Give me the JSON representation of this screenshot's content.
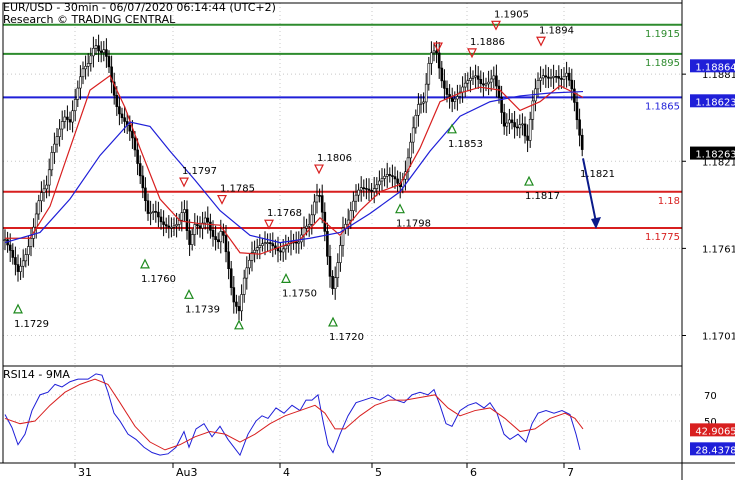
{
  "header": {
    "title": "EUR/USD - 30min - 06/07/2020 06:14:44 (UTC+2)",
    "source": "Research © TRADING CENTRAL"
  },
  "rsi_panel": {
    "title": "RSI14 - 9MA"
  },
  "chart_data": [
    {
      "type": "line",
      "name": "price-panel",
      "ylim": [
        1.168,
        1.193
      ],
      "xlim": [
        0,
        735
      ],
      "y_ticks": [
        "1.1881",
        "1.1821",
        "1.1761",
        "1.1701"
      ],
      "levels": [
        {
          "value": 1.1915,
          "label": "1.1915",
          "color": "#2e8b2e"
        },
        {
          "value": 1.1895,
          "label": "1.1895",
          "color": "#2e8b2e"
        },
        {
          "value": 1.1865,
          "label": "1.1865",
          "color": "#1f1fd8"
        },
        {
          "value": 1.18,
          "label": "1.18",
          "color": "#d81f1f"
        },
        {
          "value": 1.1775,
          "label": "1.1775",
          "color": "#d81f1f"
        }
      ],
      "price_badges": [
        {
          "value": 1.18864,
          "label": "1.18864",
          "bg": "#1f1fd8"
        },
        {
          "value": 1.18623,
          "label": "1.18623",
          "bg": "#1f1fd8"
        },
        {
          "value": 1.18263,
          "label": "1.18263",
          "bg": "#000000"
        }
      ],
      "pivots": [
        {
          "x": 18,
          "kind": "low",
          "price": 1.1729,
          "label": "1.1729"
        },
        {
          "x": 145,
          "kind": "low",
          "price": 1.176,
          "label": "1.1760"
        },
        {
          "x": 184,
          "kind": "high",
          "price": 1.1797,
          "label": "1.1797"
        },
        {
          "x": 189,
          "kind": "low",
          "price": 1.1739,
          "label": "1.1739"
        },
        {
          "x": 222,
          "kind": "high",
          "price": 1.1785,
          "label": "1.1785"
        },
        {
          "x": 239,
          "kind": "low",
          "price": null,
          "label": ""
        },
        {
          "x": 269,
          "kind": "high",
          "price": 1.1768,
          "label": "1.1768"
        },
        {
          "x": 286,
          "kind": "low",
          "price": 1.175,
          "label": "1.1750"
        },
        {
          "x": 319,
          "kind": "high",
          "price": 1.1806,
          "label": "1.1806"
        },
        {
          "x": 333,
          "kind": "low",
          "price": 1.172,
          "label": "1.1720"
        },
        {
          "x": 400,
          "kind": "low",
          "price": 1.1798,
          "label": "1.1798"
        },
        {
          "x": 438,
          "kind": "high",
          "price": null,
          "label": ""
        },
        {
          "x": 452,
          "kind": "low",
          "price": 1.1853,
          "label": "1.1853"
        },
        {
          "x": 472,
          "kind": "high",
          "price": 1.1886,
          "label": "1.1886"
        },
        {
          "x": 496,
          "kind": "high",
          "price": 1.1905,
          "label": "1.1905"
        },
        {
          "x": 529,
          "kind": "low",
          "price": 1.1817,
          "label": "1.1817"
        },
        {
          "x": 541,
          "kind": "high",
          "price": 1.1894,
          "label": "1.1894"
        }
      ],
      "last_price_label": "1.1821",
      "forecast_arrow": {
        "from": {
          "x": 583,
          "price": 1.1823
        },
        "to": {
          "x": 596,
          "price": 1.1775
        },
        "color": "#0a1a8a"
      },
      "path": [
        [
          5,
          1.1767
        ],
        [
          10,
          1.176
        ],
        [
          18,
          1.1745
        ],
        [
          25,
          1.1755
        ],
        [
          32,
          1.177
        ],
        [
          40,
          1.1798
        ],
        [
          47,
          1.1805
        ],
        [
          52,
          1.1828
        ],
        [
          58,
          1.184
        ],
        [
          64,
          1.1852
        ],
        [
          70,
          1.1848
        ],
        [
          76,
          1.1866
        ],
        [
          82,
          1.1884
        ],
        [
          88,
          1.1888
        ],
        [
          95,
          1.1902
        ],
        [
          100,
          1.1895
        ],
        [
          104,
          1.1898
        ],
        [
          108,
          1.189
        ],
        [
          113,
          1.187
        ],
        [
          118,
          1.1855
        ],
        [
          123,
          1.185
        ],
        [
          128,
          1.1845
        ],
        [
          133,
          1.1836
        ],
        [
          138,
          1.1818
        ],
        [
          143,
          1.1802
        ],
        [
          148,
          1.1785
        ],
        [
          155,
          1.1787
        ],
        [
          162,
          1.1778
        ],
        [
          170,
          1.1775
        ],
        [
          178,
          1.1778
        ],
        [
          184,
          1.179
        ],
        [
          189,
          1.1762
        ],
        [
          195,
          1.1778
        ],
        [
          200,
          1.1775
        ],
        [
          206,
          1.1783
        ],
        [
          212,
          1.177
        ],
        [
          218,
          1.1765
        ],
        [
          222,
          1.1776
        ],
        [
          228,
          1.175
        ],
        [
          233,
          1.1725
        ],
        [
          239,
          1.1718
        ],
        [
          245,
          1.1744
        ],
        [
          252,
          1.1758
        ],
        [
          258,
          1.1762
        ],
        [
          264,
          1.1765
        ],
        [
          269,
          1.1765
        ],
        [
          274,
          1.1762
        ],
        [
          280,
          1.1758
        ],
        [
          286,
          1.1763
        ],
        [
          292,
          1.1766
        ],
        [
          298,
          1.1764
        ],
        [
          304,
          1.1775
        ],
        [
          310,
          1.1778
        ],
        [
          315,
          1.1795
        ],
        [
          319,
          1.18
        ],
        [
          324,
          1.1778
        ],
        [
          329,
          1.1745
        ],
        [
          333,
          1.1732
        ],
        [
          338,
          1.1752
        ],
        [
          343,
          1.1775
        ],
        [
          348,
          1.178
        ],
        [
          354,
          1.1795
        ],
        [
          360,
          1.1803
        ],
        [
          366,
          1.1802
        ],
        [
          372,
          1.18
        ],
        [
          380,
          1.1808
        ],
        [
          387,
          1.1812
        ],
        [
          394,
          1.181
        ],
        [
          400,
          1.1803
        ],
        [
          406,
          1.1815
        ],
        [
          412,
          1.184
        ],
        [
          418,
          1.186
        ],
        [
          424,
          1.1862
        ],
        [
          430,
          1.1895
        ],
        [
          436,
          1.1898
        ],
        [
          441,
          1.1878
        ],
        [
          446,
          1.1868
        ],
        [
          452,
          1.1862
        ],
        [
          458,
          1.1866
        ],
        [
          464,
          1.1874
        ],
        [
          470,
          1.1878
        ],
        [
          476,
          1.188
        ],
        [
          482,
          1.1873
        ],
        [
          488,
          1.1875
        ],
        [
          494,
          1.188
        ],
        [
          499,
          1.1865
        ],
        [
          504,
          1.1845
        ],
        [
          510,
          1.185
        ],
        [
          516,
          1.1843
        ],
        [
          522,
          1.1848
        ],
        [
          527,
          1.1832
        ],
        [
          532,
          1.186
        ],
        [
          537,
          1.1876
        ],
        [
          543,
          1.188
        ],
        [
          549,
          1.1878
        ],
        [
          555,
          1.188
        ],
        [
          561,
          1.1877
        ],
        [
          567,
          1.1882
        ],
        [
          573,
          1.1868
        ],
        [
          578,
          1.1845
        ],
        [
          583,
          1.1826
        ]
      ],
      "ma_red": [
        [
          5,
          1.1768
        ],
        [
          30,
          1.1768
        ],
        [
          50,
          1.179
        ],
        [
          70,
          1.183
        ],
        [
          90,
          1.187
        ],
        [
          110,
          1.188
        ],
        [
          125,
          1.1858
        ],
        [
          140,
          1.183
        ],
        [
          160,
          1.1795
        ],
        [
          180,
          1.178
        ],
        [
          200,
          1.1778
        ],
        [
          220,
          1.1777
        ],
        [
          240,
          1.1758
        ],
        [
          260,
          1.1757
        ],
        [
          280,
          1.1762
        ],
        [
          300,
          1.1767
        ],
        [
          320,
          1.1782
        ],
        [
          340,
          1.177
        ],
        [
          360,
          1.1787
        ],
        [
          380,
          1.18
        ],
        [
          400,
          1.1805
        ],
        [
          420,
          1.183
        ],
        [
          440,
          1.1862
        ],
        [
          460,
          1.1868
        ],
        [
          480,
          1.1872
        ],
        [
          500,
          1.187
        ],
        [
          520,
          1.1856
        ],
        [
          540,
          1.1862
        ],
        [
          560,
          1.1873
        ],
        [
          583,
          1.1865
        ]
      ],
      "ma_blue": [
        [
          5,
          1.1765
        ],
        [
          40,
          1.1772
        ],
        [
          70,
          1.1795
        ],
        [
          100,
          1.1825
        ],
        [
          130,
          1.1848
        ],
        [
          150,
          1.1845
        ],
        [
          170,
          1.1828
        ],
        [
          195,
          1.1808
        ],
        [
          220,
          1.1787
        ],
        [
          250,
          1.177
        ],
        [
          280,
          1.1765
        ],
        [
          310,
          1.1768
        ],
        [
          340,
          1.1772
        ],
        [
          370,
          1.1785
        ],
        [
          400,
          1.18
        ],
        [
          430,
          1.1828
        ],
        [
          460,
          1.1852
        ],
        [
          490,
          1.1862
        ],
        [
          520,
          1.1866
        ],
        [
          550,
          1.1868
        ],
        [
          583,
          1.1869
        ]
      ]
    },
    {
      "type": "line",
      "name": "rsi-panel",
      "ylim": [
        18,
        92
      ],
      "xlim": [
        0,
        735
      ],
      "y_ticks": [
        "70",
        "50"
      ],
      "badges": [
        {
          "value": 42.9065,
          "label": "42.9065",
          "bg": "#d81f1f"
        },
        {
          "value": 28.4378,
          "label": "28.4378",
          "bg": "#1f1fd8"
        }
      ],
      "rsi": [
        [
          5,
          55
        ],
        [
          12,
          45
        ],
        [
          18,
          32
        ],
        [
          25,
          40
        ],
        [
          32,
          58
        ],
        [
          40,
          70
        ],
        [
          48,
          72
        ],
        [
          55,
          78
        ],
        [
          62,
          76
        ],
        [
          70,
          80
        ],
        [
          78,
          82
        ],
        [
          88,
          82
        ],
        [
          96,
          86
        ],
        [
          102,
          85
        ],
        [
          108,
          72
        ],
        [
          114,
          56
        ],
        [
          120,
          50
        ],
        [
          128,
          40
        ],
        [
          136,
          36
        ],
        [
          144,
          30
        ],
        [
          152,
          26
        ],
        [
          160,
          24
        ],
        [
          168,
          25
        ],
        [
          176,
          30
        ],
        [
          184,
          42
        ],
        [
          189,
          30
        ],
        [
          196,
          44
        ],
        [
          204,
          48
        ],
        [
          212,
          38
        ],
        [
          220,
          46
        ],
        [
          228,
          36
        ],
        [
          234,
          30
        ],
        [
          240,
          24
        ],
        [
          248,
          40
        ],
        [
          256,
          50
        ],
        [
          262,
          54
        ],
        [
          268,
          52
        ],
        [
          276,
          60
        ],
        [
          284,
          56
        ],
        [
          292,
          62
        ],
        [
          300,
          58
        ],
        [
          306,
          66
        ],
        [
          312,
          66
        ],
        [
          318,
          70
        ],
        [
          323,
          50
        ],
        [
          328,
          32
        ],
        [
          333,
          26
        ],
        [
          340,
          40
        ],
        [
          348,
          54
        ],
        [
          356,
          64
        ],
        [
          364,
          66
        ],
        [
          372,
          68
        ],
        [
          380,
          66
        ],
        [
          388,
          70
        ],
        [
          396,
          66
        ],
        [
          404,
          64
        ],
        [
          412,
          70
        ],
        [
          420,
          72
        ],
        [
          428,
          70
        ],
        [
          434,
          74
        ],
        [
          440,
          62
        ],
        [
          446,
          48
        ],
        [
          452,
          46
        ],
        [
          460,
          58
        ],
        [
          468,
          62
        ],
        [
          476,
          64
        ],
        [
          484,
          60
        ],
        [
          490,
          64
        ],
        [
          497,
          56
        ],
        [
          504,
          40
        ],
        [
          510,
          36
        ],
        [
          518,
          40
        ],
        [
          526,
          34
        ],
        [
          532,
          48
        ],
        [
          538,
          56
        ],
        [
          546,
          58
        ],
        [
          554,
          56
        ],
        [
          562,
          58
        ],
        [
          570,
          55
        ],
        [
          576,
          40
        ],
        [
          580,
          28
        ]
      ],
      "ma": [
        [
          5,
          52
        ],
        [
          20,
          48
        ],
        [
          35,
          50
        ],
        [
          50,
          62
        ],
        [
          65,
          72
        ],
        [
          80,
          78
        ],
        [
          95,
          82
        ],
        [
          108,
          78
        ],
        [
          120,
          64
        ],
        [
          135,
          46
        ],
        [
          150,
          34
        ],
        [
          165,
          28
        ],
        [
          180,
          32
        ],
        [
          195,
          38
        ],
        [
          210,
          42
        ],
        [
          225,
          40
        ],
        [
          240,
          34
        ],
        [
          255,
          40
        ],
        [
          270,
          48
        ],
        [
          285,
          54
        ],
        [
          300,
          58
        ],
        [
          315,
          62
        ],
        [
          325,
          56
        ],
        [
          335,
          44
        ],
        [
          345,
          44
        ],
        [
          360,
          54
        ],
        [
          375,
          62
        ],
        [
          390,
          66
        ],
        [
          405,
          66
        ],
        [
          420,
          68
        ],
        [
          435,
          70
        ],
        [
          448,
          60
        ],
        [
          460,
          54
        ],
        [
          475,
          58
        ],
        [
          490,
          60
        ],
        [
          505,
          52
        ],
        [
          520,
          42
        ],
        [
          535,
          44
        ],
        [
          550,
          52
        ],
        [
          565,
          56
        ],
        [
          575,
          52
        ],
        [
          583,
          44
        ]
      ]
    }
  ],
  "x_axis": {
    "labels": [
      "31",
      "Au3",
      "4",
      "5",
      "6",
      "7"
    ],
    "positions": [
      75,
      173,
      280,
      372,
      467,
      564
    ]
  },
  "colors": {
    "candle": "#000000",
    "ma_red": "#d81f1f",
    "ma_blue": "#1f1fd8",
    "rsi_line": "#1f1fd8",
    "rsi_ma": "#d81f1f",
    "grid": "#c8c8c8",
    "high_marker": "#d81f1f",
    "low_marker": "#1e8a1e"
  }
}
